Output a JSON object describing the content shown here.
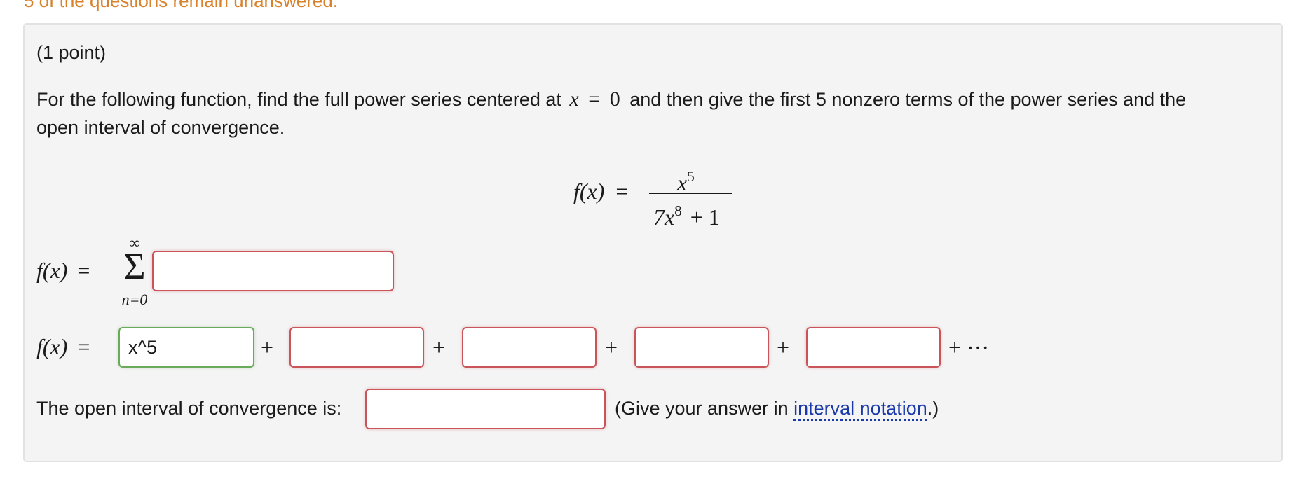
{
  "warning": "5 of the questions remain unanswered.",
  "problem": {
    "points": "(1 point)",
    "instructions_part1": "For the following function, find the full power series centered at",
    "center_var": "x",
    "center_eq": "=",
    "center_val": "0",
    "instructions_part2": "and then give the first 5 nonzero terms of the power series and the",
    "instructions_line2": "open interval of convergence.",
    "function_lhs": "f(x)",
    "equals": "=",
    "numerator_base": "x",
    "numerator_exp": "5",
    "denominator_coef": "7x",
    "denominator_exp": "8",
    "denominator_rest": "+ 1"
  },
  "series": {
    "lhs": "f(x)",
    "equals": "=",
    "sigma": "Σ",
    "upper": "∞",
    "lower": "n=0",
    "input_value": ""
  },
  "terms": {
    "lhs": "f(x)",
    "equals": "=",
    "plus": "+",
    "ellipsis": "+ ···",
    "values": [
      "x^5",
      "",
      "",
      "",
      ""
    ]
  },
  "interval": {
    "label": "The open interval of convergence is:",
    "input_value": "",
    "hint_before": "(Give your answer in",
    "hint_link": "interval notation",
    "hint_after": ".)"
  },
  "colors": {
    "warning": "#d9822b",
    "incorrect_border": "#c9545a",
    "correct_border": "#6aab5b",
    "link": "#1a39a8"
  }
}
